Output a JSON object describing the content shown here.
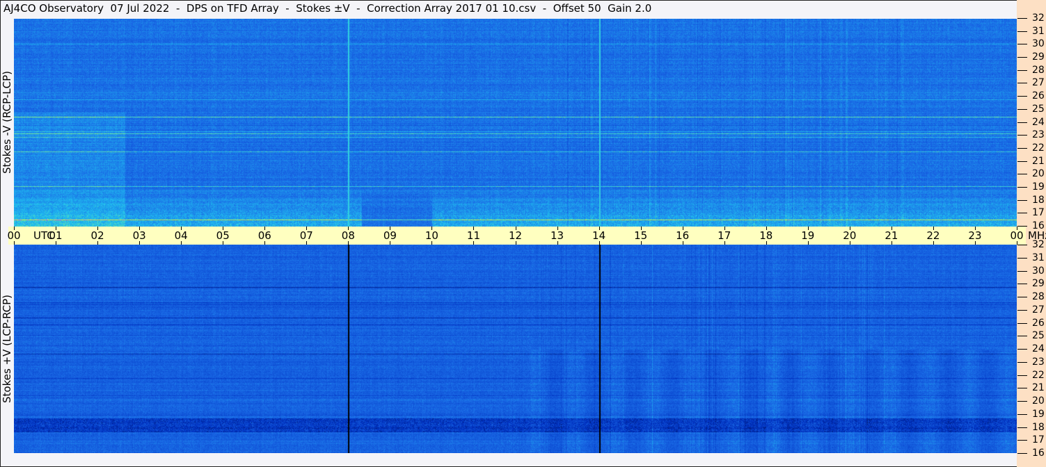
{
  "title": "AJ4CO Observatory  07 Jul 2022  -  DPS on TFD Array  -  Stokes ±V  -  Correction Array 2017 01 10.csv  -  Offset 50  Gain 2.0",
  "chart_data": {
    "type": "heatmap",
    "x_unit": "UTC",
    "y_unit": "MHz",
    "x_ticks": [
      "00",
      "01",
      "02",
      "03",
      "04",
      "05",
      "06",
      "07",
      "08",
      "09",
      "10",
      "11",
      "12",
      "13",
      "14",
      "15",
      "16",
      "17",
      "18",
      "19",
      "20",
      "21",
      "22",
      "23",
      "00"
    ],
    "xlim_hours": [
      0,
      24
    ],
    "y_ticks": [
      32,
      31,
      30,
      29,
      28,
      27,
      26,
      25,
      24,
      23,
      22,
      21,
      20,
      19,
      18,
      17,
      16
    ],
    "ylim": [
      16,
      32
    ],
    "vertical_lines_utc_hours": [
      8,
      14
    ],
    "colorscale": [
      "#000a40",
      "#0030c0",
      "#1a6ae6",
      "#20c0f0",
      "#80f090",
      "#f0f020",
      "#ff40ff",
      "#ffffff"
    ],
    "panels": [
      {
        "ylabel": "Stokes -V (RCP-LCP)",
        "line_color": "#30d0e0"
      },
      {
        "ylabel": "Stokes +V (LCP-RCP)",
        "line_color": "#000000"
      }
    ]
  },
  "colors": {
    "axis_strip": "#ffffc0",
    "right_strip": "#fde0c4",
    "background": "#f4f4f8"
  }
}
